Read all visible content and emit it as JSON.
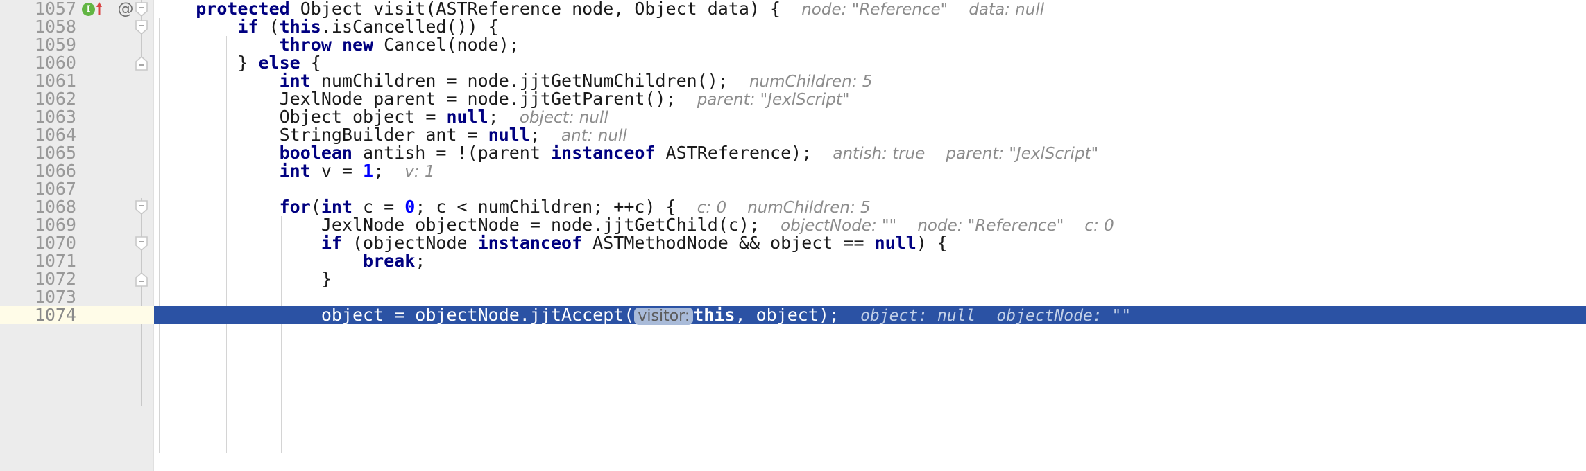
{
  "editor": {
    "first_line": 1057,
    "last_line": 1074,
    "selected_line": 1074,
    "gutter_bg": "#ECECEC",
    "selection_bg": "#2B52A4",
    "selected_gutter_bg": "#FFFCE8",
    "keyword_color": "#000080",
    "hint_color": "#8C8C8C",
    "line_number_color": "#999999"
  },
  "gutter_icons": {
    "implementation_icon": "implementing-method-icon",
    "implementation_letter": "I",
    "override_icon": "at-annotation-icon",
    "override_label": "@"
  },
  "lines": [
    {
      "number": "1057",
      "indent": 4,
      "tokens": [
        {
          "t": "protected",
          "c": "kw"
        },
        {
          "t": " Object visit(ASTReference node, Object data) {",
          "c": "pl"
        }
      ],
      "hints": [
        "node: \"Reference\"",
        "data: null"
      ]
    },
    {
      "number": "1058",
      "indent": 8,
      "tokens": [
        {
          "t": "if",
          "c": "kw"
        },
        {
          "t": " (",
          "c": "pl"
        },
        {
          "t": "this",
          "c": "kw"
        },
        {
          "t": ".isCancelled()) {",
          "c": "pl"
        }
      ],
      "hints": []
    },
    {
      "number": "1059",
      "indent": 12,
      "tokens": [
        {
          "t": "throw",
          "c": "kw"
        },
        {
          "t": " ",
          "c": "pl"
        },
        {
          "t": "new",
          "c": "kw"
        },
        {
          "t": " Cancel(node);",
          "c": "pl"
        }
      ],
      "hints": []
    },
    {
      "number": "1060",
      "indent": 8,
      "tokens": [
        {
          "t": "} ",
          "c": "pl"
        },
        {
          "t": "else",
          "c": "kw"
        },
        {
          "t": " {",
          "c": "pl"
        }
      ],
      "hints": []
    },
    {
      "number": "1061",
      "indent": 12,
      "tokens": [
        {
          "t": "int",
          "c": "kw"
        },
        {
          "t": " numChildren = node.jjtGetNumChildren();",
          "c": "pl"
        }
      ],
      "hints": [
        "numChildren: 5"
      ]
    },
    {
      "number": "1062",
      "indent": 12,
      "tokens": [
        {
          "t": "JexlNode parent = node.jjtGetParent();",
          "c": "pl"
        }
      ],
      "hints": [
        "parent: \"JexlScript\""
      ]
    },
    {
      "number": "1063",
      "indent": 12,
      "tokens": [
        {
          "t": "Object object = ",
          "c": "pl"
        },
        {
          "t": "null",
          "c": "kw"
        },
        {
          "t": ";",
          "c": "pl"
        }
      ],
      "hints": [
        "object: null"
      ]
    },
    {
      "number": "1064",
      "indent": 12,
      "tokens": [
        {
          "t": "StringBuilder ant = ",
          "c": "pl"
        },
        {
          "t": "null",
          "c": "kw"
        },
        {
          "t": ";",
          "c": "pl"
        }
      ],
      "hints": [
        "ant: null"
      ]
    },
    {
      "number": "1065",
      "indent": 12,
      "tokens": [
        {
          "t": "boolean",
          "c": "kw"
        },
        {
          "t": " antish = !(parent ",
          "c": "pl"
        },
        {
          "t": "instanceof",
          "c": "kw"
        },
        {
          "t": " ASTReference);",
          "c": "pl"
        }
      ],
      "hints": [
        "antish: true",
        "parent: \"JexlScript\""
      ]
    },
    {
      "number": "1066",
      "indent": 12,
      "tokens": [
        {
          "t": "int",
          "c": "kw"
        },
        {
          "t": " v = ",
          "c": "pl"
        },
        {
          "t": "1",
          "c": "num"
        },
        {
          "t": ";",
          "c": "pl"
        }
      ],
      "hints": [
        "v: 1"
      ]
    },
    {
      "number": "1067",
      "indent": 0,
      "tokens": [],
      "hints": []
    },
    {
      "number": "1068",
      "indent": 12,
      "tokens": [
        {
          "t": "for",
          "c": "kw"
        },
        {
          "t": "(",
          "c": "pl"
        },
        {
          "t": "int",
          "c": "kw"
        },
        {
          "t": " c = ",
          "c": "pl"
        },
        {
          "t": "0",
          "c": "num"
        },
        {
          "t": "; c < numChildren; ++c) {",
          "c": "pl"
        }
      ],
      "hints": [
        "c: 0",
        "numChildren: 5"
      ]
    },
    {
      "number": "1069",
      "indent": 16,
      "tokens": [
        {
          "t": "JexlNode objectNode = node.jjtGetChild(c);",
          "c": "pl"
        }
      ],
      "hints": [
        "objectNode: \"\"",
        "node: \"Reference\"",
        "c: 0"
      ]
    },
    {
      "number": "1070",
      "indent": 16,
      "tokens": [
        {
          "t": "if",
          "c": "kw"
        },
        {
          "t": " (objectNode ",
          "c": "pl"
        },
        {
          "t": "instanceof",
          "c": "kw"
        },
        {
          "t": " ASTMethodNode && object == ",
          "c": "pl"
        },
        {
          "t": "null",
          "c": "kw"
        },
        {
          "t": ") {",
          "c": "pl"
        }
      ],
      "hints": []
    },
    {
      "number": "1071",
      "indent": 20,
      "tokens": [
        {
          "t": "break",
          "c": "kw"
        },
        {
          "t": ";",
          "c": "pl"
        }
      ],
      "hints": []
    },
    {
      "number": "1072",
      "indent": 16,
      "tokens": [
        {
          "t": "}",
          "c": "pl"
        }
      ],
      "hints": []
    },
    {
      "number": "1073",
      "indent": 0,
      "tokens": [],
      "hints": []
    },
    {
      "number": "1074",
      "indent": 16,
      "selected": true,
      "tokens": [
        {
          "t": "object = objectNode.jjtAccept(",
          "c": "pl"
        },
        {
          "t": "visitor:",
          "c": "phint"
        },
        {
          "t": "this",
          "c": "kw"
        },
        {
          "t": ", object);",
          "c": "pl"
        }
      ],
      "hints": [
        "object: null",
        "objectNode: \"\""
      ]
    }
  ]
}
